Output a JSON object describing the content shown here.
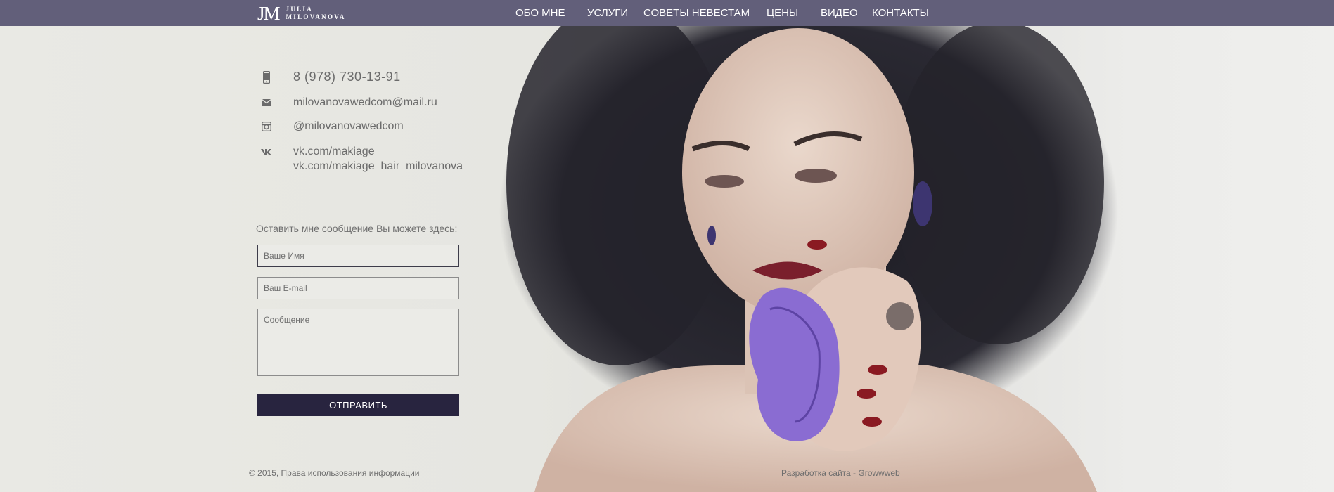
{
  "header": {
    "logo_mark": "JM",
    "logo_line1": "JULIA",
    "logo_line2": "MILOVANOVA",
    "nav": [
      {
        "label": "ОБО МНЕ"
      },
      {
        "label": "УСЛУГИ"
      },
      {
        "label": "СОВЕТЫ НЕВЕСТАМ"
      },
      {
        "label": "ЦЕНЫ"
      },
      {
        "label": "ВИДЕО"
      },
      {
        "label": "КОНТАКТЫ"
      }
    ]
  },
  "contacts": {
    "phone": "8 (978) 730-13-91",
    "email": "milovanovawedcom@mail.ru",
    "instagram": "@milovanovawedcom",
    "vk1": "vk.com/makiage",
    "vk2": "vk.com/makiage_hair_milovanova"
  },
  "form": {
    "caption": "Оставить мне сообщение Вы можете здесь:",
    "name_placeholder": "Ваше Имя",
    "email_placeholder": "Ваш E-mail",
    "message_placeholder": "Сообщение",
    "submit_label": "ОТПРАВИТЬ"
  },
  "footer": {
    "copyright": "© 2015, Права использования информации",
    "developer": "Разработка сайта - Growwweb"
  },
  "colors": {
    "header_bg": "#625f7a",
    "button_bg": "#28243f",
    "page_bg": "#e8e8e3"
  },
  "icons": [
    "phone-icon",
    "mail-icon",
    "instagram-icon",
    "vk-icon"
  ]
}
